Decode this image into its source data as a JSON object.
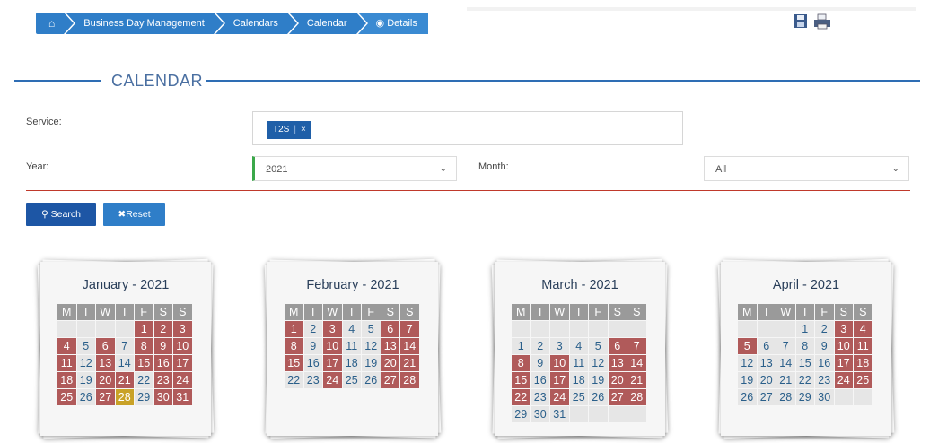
{
  "breadcrumb": {
    "items": [
      "Business Day Management",
      "Calendars",
      "Calendar"
    ],
    "current": "Details"
  },
  "section": {
    "title": "CALENDAR"
  },
  "form": {
    "service_label": "Service:",
    "service_tags": [
      "T2S"
    ],
    "year_label": "Year:",
    "year_value": "2021",
    "month_label": "Month:",
    "month_value": "All",
    "search_label": "Search",
    "reset_label": "Reset"
  },
  "calendars": [
    {
      "title": "January - 2021",
      "headers": [
        "M",
        "T",
        "W",
        "T",
        "F",
        "S",
        "S"
      ],
      "weeks": [
        [
          [
            "",
            "e"
          ],
          [
            "",
            "e"
          ],
          [
            "",
            "e"
          ],
          [
            "",
            "e"
          ],
          [
            "1",
            "h"
          ],
          [
            "2",
            "w"
          ],
          [
            "3",
            "w"
          ]
        ],
        [
          [
            "4",
            "h"
          ],
          [
            "5",
            "d"
          ],
          [
            "6",
            "h"
          ],
          [
            "7",
            "d"
          ],
          [
            "8",
            "h"
          ],
          [
            "9",
            "w"
          ],
          [
            "10",
            "w"
          ]
        ],
        [
          [
            "11",
            "h"
          ],
          [
            "12",
            "d"
          ],
          [
            "13",
            "h"
          ],
          [
            "14",
            "d"
          ],
          [
            "15",
            "h"
          ],
          [
            "16",
            "w"
          ],
          [
            "17",
            "w"
          ]
        ],
        [
          [
            "18",
            "h"
          ],
          [
            "19",
            "d"
          ],
          [
            "20",
            "h"
          ],
          [
            "21",
            "h"
          ],
          [
            "22",
            "d"
          ],
          [
            "23",
            "w"
          ],
          [
            "24",
            "w"
          ]
        ],
        [
          [
            "25",
            "h"
          ],
          [
            "26",
            "d"
          ],
          [
            "27",
            "h"
          ],
          [
            "28",
            "t"
          ],
          [
            "29",
            "d"
          ],
          [
            "30",
            "w"
          ],
          [
            "31",
            "w"
          ]
        ]
      ]
    },
    {
      "title": "February - 2021",
      "headers": [
        "M",
        "T",
        "W",
        "T",
        "F",
        "S",
        "S"
      ],
      "weeks": [
        [
          [
            "1",
            "h"
          ],
          [
            "2",
            "d"
          ],
          [
            "3",
            "h"
          ],
          [
            "4",
            "d"
          ],
          [
            "5",
            "d"
          ],
          [
            "6",
            "w"
          ],
          [
            "7",
            "w"
          ]
        ],
        [
          [
            "8",
            "h"
          ],
          [
            "9",
            "d"
          ],
          [
            "10",
            "h"
          ],
          [
            "11",
            "d"
          ],
          [
            "12",
            "d"
          ],
          [
            "13",
            "w"
          ],
          [
            "14",
            "w"
          ]
        ],
        [
          [
            "15",
            "h"
          ],
          [
            "16",
            "d"
          ],
          [
            "17",
            "h"
          ],
          [
            "18",
            "d"
          ],
          [
            "19",
            "d"
          ],
          [
            "20",
            "w"
          ],
          [
            "21",
            "w"
          ]
        ],
        [
          [
            "22",
            "d"
          ],
          [
            "23",
            "d"
          ],
          [
            "24",
            "h"
          ],
          [
            "25",
            "d"
          ],
          [
            "26",
            "d"
          ],
          [
            "27",
            "w"
          ],
          [
            "28",
            "w"
          ]
        ]
      ]
    },
    {
      "title": "March - 2021",
      "headers": [
        "M",
        "T",
        "W",
        "T",
        "F",
        "S",
        "S"
      ],
      "weeks": [
        [
          [
            "",
            "e"
          ],
          [
            "",
            "e"
          ],
          [
            "",
            "e"
          ],
          [
            "",
            "e"
          ],
          [
            "",
            "e"
          ],
          [
            "",
            "e"
          ],
          [
            "",
            "e"
          ]
        ],
        [
          [
            "1",
            "d"
          ],
          [
            "2",
            "d"
          ],
          [
            "3",
            "d"
          ],
          [
            "4",
            "d"
          ],
          [
            "5",
            "d"
          ],
          [
            "6",
            "w"
          ],
          [
            "7",
            "w"
          ]
        ],
        [
          [
            "8",
            "h"
          ],
          [
            "9",
            "d"
          ],
          [
            "10",
            "h"
          ],
          [
            "11",
            "d"
          ],
          [
            "12",
            "d"
          ],
          [
            "13",
            "w"
          ],
          [
            "14",
            "w"
          ]
        ],
        [
          [
            "15",
            "h"
          ],
          [
            "16",
            "d"
          ],
          [
            "17",
            "h"
          ],
          [
            "18",
            "d"
          ],
          [
            "19",
            "d"
          ],
          [
            "20",
            "w"
          ],
          [
            "21",
            "w"
          ]
        ],
        [
          [
            "22",
            "h"
          ],
          [
            "23",
            "d"
          ],
          [
            "24",
            "h"
          ],
          [
            "25",
            "d"
          ],
          [
            "26",
            "d"
          ],
          [
            "27",
            "w"
          ],
          [
            "28",
            "w"
          ]
        ],
        [
          [
            "29",
            "d"
          ],
          [
            "30",
            "d"
          ],
          [
            "31",
            "d"
          ],
          [
            "",
            "e"
          ],
          [
            "",
            "e"
          ],
          [
            "",
            "e"
          ],
          [
            "",
            "e"
          ]
        ]
      ]
    },
    {
      "title": "April - 2021",
      "headers": [
        "M",
        "T",
        "W",
        "T",
        "F",
        "S",
        "S"
      ],
      "weeks": [
        [
          [
            "",
            "e"
          ],
          [
            "",
            "e"
          ],
          [
            "",
            "e"
          ],
          [
            "1",
            "d"
          ],
          [
            "2",
            "d"
          ],
          [
            "3",
            "w"
          ],
          [
            "4",
            "w"
          ]
        ],
        [
          [
            "5",
            "h"
          ],
          [
            "6",
            "d"
          ],
          [
            "7",
            "d"
          ],
          [
            "8",
            "d"
          ],
          [
            "9",
            "d"
          ],
          [
            "10",
            "w"
          ],
          [
            "11",
            "w"
          ]
        ],
        [
          [
            "12",
            "d"
          ],
          [
            "13",
            "d"
          ],
          [
            "14",
            "d"
          ],
          [
            "15",
            "d"
          ],
          [
            "16",
            "d"
          ],
          [
            "17",
            "w"
          ],
          [
            "18",
            "w"
          ]
        ],
        [
          [
            "19",
            "d"
          ],
          [
            "20",
            "d"
          ],
          [
            "21",
            "d"
          ],
          [
            "22",
            "d"
          ],
          [
            "23",
            "d"
          ],
          [
            "24",
            "w"
          ],
          [
            "25",
            "w"
          ]
        ],
        [
          [
            "26",
            "d"
          ],
          [
            "27",
            "d"
          ],
          [
            "28",
            "d"
          ],
          [
            "29",
            "d"
          ],
          [
            "30",
            "d"
          ],
          [
            "",
            "e"
          ],
          [
            "",
            "e"
          ]
        ]
      ]
    }
  ],
  "colors": {
    "breadcrumb_bg": "#2f7ec8",
    "primary_button": "#1d56a5",
    "holiday_cell": "#b05a5a",
    "today_cell": "#c9a227",
    "workday_text": "#2a5f8a"
  },
  "icons": [
    "home-icon",
    "eye-icon",
    "save-icon",
    "print-icon",
    "search-icon",
    "close-icon",
    "chevron-down-icon"
  ]
}
